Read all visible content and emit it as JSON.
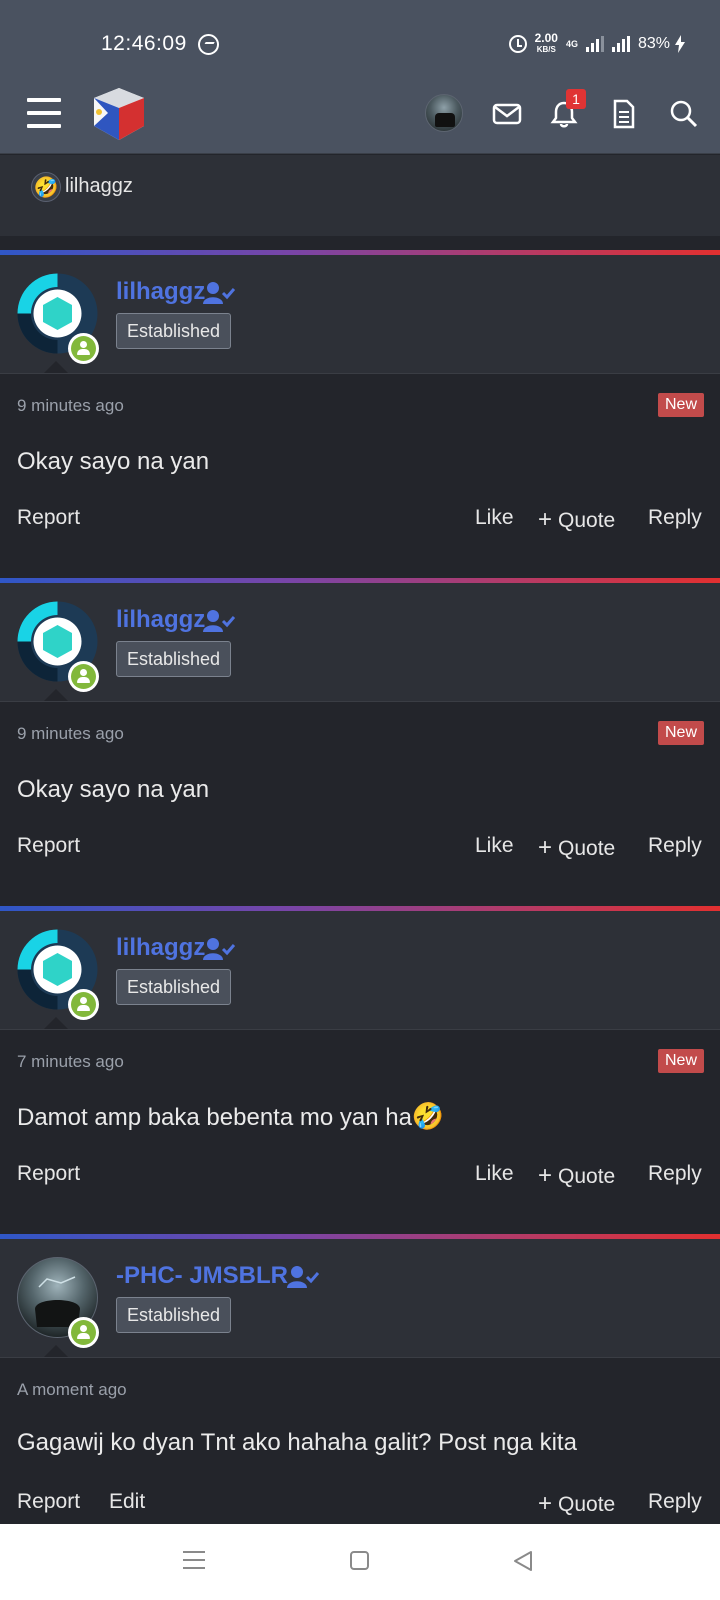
{
  "status_bar": {
    "time": "12:46:09",
    "speed_value": "2.00",
    "speed_unit": "KB/S",
    "network": "4G",
    "battery": "83%",
    "icons": [
      "messenger-icon",
      "alarm-icon",
      "signal-icon",
      "battery-charging-icon"
    ]
  },
  "header": {
    "icons": [
      "menu-icon",
      "site-logo",
      "avatar",
      "mail-icon",
      "bell-icon",
      "document-icon",
      "search-icon"
    ],
    "notification_count": "1"
  },
  "previous_block": {
    "emoji": "🤣",
    "name": "lilhaggz"
  },
  "posts": [
    {
      "username": "lilhaggz",
      "rank": "Established",
      "time": "9 minutes ago",
      "badge": "New",
      "text": "Okay sayo na yan",
      "emoji": "",
      "actions": {
        "left1": "Report",
        "like": "Like",
        "quote": "Quote",
        "reply": "Reply"
      }
    },
    {
      "username": "lilhaggz",
      "rank": "Established",
      "time": "9 minutes ago",
      "badge": "New",
      "text": "Okay sayo na yan",
      "emoji": "",
      "actions": {
        "left1": "Report",
        "like": "Like",
        "quote": "Quote",
        "reply": "Reply"
      }
    },
    {
      "username": "lilhaggz",
      "rank": "Established",
      "time": "7 minutes ago",
      "badge": "New",
      "text": "Damot amp baka bebenta mo yan ha",
      "emoji": "🤣",
      "actions": {
        "left1": "Report",
        "like": "Like",
        "quote": "Quote",
        "reply": "Reply"
      }
    },
    {
      "username": "-PHC- JMSBLR",
      "rank": "Established",
      "time": "A moment ago",
      "text": "Gagawij ko dyan Tnt ako hahaha galit? Post nga kita",
      "actions": {
        "left1": "Report",
        "edit": "Edit",
        "quote": "Quote",
        "reply": "Reply"
      }
    }
  ],
  "nav_bar": {
    "icons": [
      "recents-icon",
      "home-icon",
      "back-icon"
    ]
  },
  "colors": {
    "username": "#4f73e0",
    "new_badge": "#c24b4b",
    "online": "#82b83b",
    "header_bg": "#4a5260",
    "post_bg": "#23252b",
    "user_bg": "#2d3037"
  }
}
